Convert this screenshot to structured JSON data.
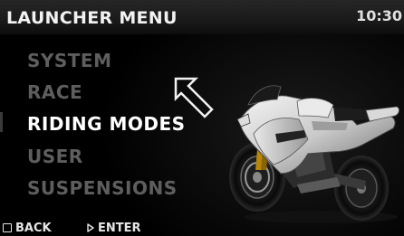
{
  "header": {
    "title": "LAUNCHER MENU",
    "clock": "10:30"
  },
  "menu": {
    "items": [
      {
        "label": "SYSTEM",
        "selected": false
      },
      {
        "label": "RACE",
        "selected": false
      },
      {
        "label": "RIDING MODES",
        "selected": true
      },
      {
        "label": "USER",
        "selected": false
      },
      {
        "label": "SUSPENSIONS",
        "selected": false
      }
    ]
  },
  "footer": {
    "back_label": "BACK",
    "enter_label": "ENTER",
    "back_icon": "square-icon",
    "enter_icon": "triangle-right-icon"
  },
  "colors": {
    "background": "#000000",
    "selected_text": "#ffffff",
    "unselected_text": "#5e5e5e",
    "header_bg": "#1f1f1f"
  }
}
